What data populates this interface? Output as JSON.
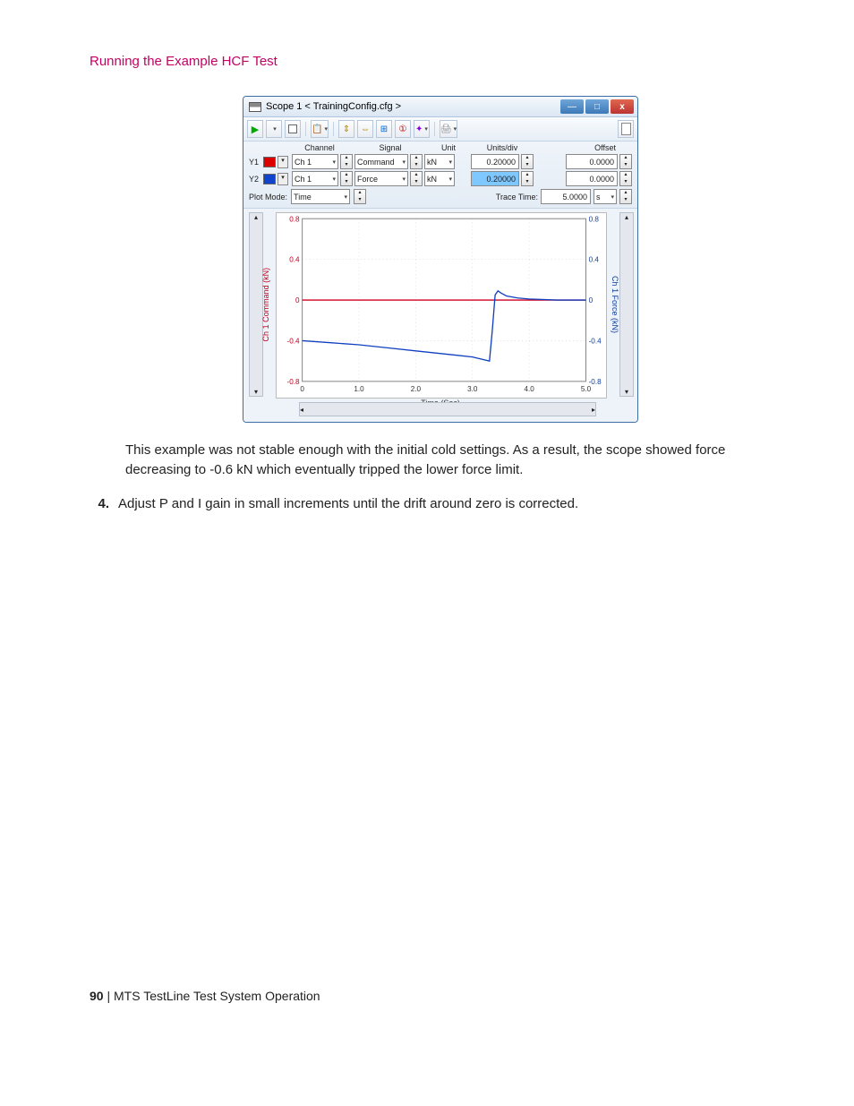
{
  "header": "Running the Example HCF Test",
  "window": {
    "title": "Scope 1 < TrainingConfig.cfg >"
  },
  "config": {
    "hdr_channel": "Channel",
    "hdr_signal": "Signal",
    "hdr_unit": "Unit",
    "hdr_unitsdiv": "Units/div",
    "hdr_offset": "Offset",
    "rows": [
      {
        "ylbl": "Y1",
        "color": "red",
        "channel": "Ch 1",
        "signal": "Command",
        "unit": "kN",
        "unitsdiv": "0.20000",
        "offset": "0.0000"
      },
      {
        "ylbl": "Y2",
        "color": "blue",
        "channel": "Ch 1",
        "signal": "Force",
        "unit": "kN",
        "unitsdiv": "0.20000",
        "offset": "0.0000"
      }
    ],
    "plotmode_label": "Plot Mode:",
    "plotmode_value": "Time",
    "tracetime_label": "Trace Time:",
    "tracetime_value": "5.0000",
    "tracetime_unit": "s"
  },
  "chart_data": {
    "type": "line",
    "xlabel": "Time (Sec)",
    "ylabel_left": "Ch 1 Command (kN)",
    "ylabel_right": "Ch 1 Force (kN)",
    "xlim": [
      0,
      5.0
    ],
    "ylim": [
      -0.8,
      0.8
    ],
    "x_ticks": [
      0,
      1.0,
      2.0,
      3.0,
      4.0,
      5.0
    ],
    "y_ticks": [
      -0.8,
      -0.4,
      0,
      0.4,
      0.8
    ],
    "series": [
      {
        "name": "Ch 1 Command",
        "color": "#d00020",
        "x": [
          0,
          5.0
        ],
        "values": [
          0.0,
          0.0
        ]
      },
      {
        "name": "Ch 1 Force",
        "color": "#1040c0",
        "x": [
          0.0,
          0.5,
          1.0,
          1.5,
          2.0,
          2.5,
          3.0,
          3.3,
          3.35,
          3.4,
          3.45,
          3.5,
          3.6,
          3.8,
          4.0,
          4.5,
          5.0
        ],
        "values": [
          -0.4,
          -0.42,
          -0.44,
          -0.47,
          -0.5,
          -0.53,
          -0.56,
          -0.6,
          -0.3,
          0.05,
          0.09,
          0.07,
          0.04,
          0.02,
          0.01,
          0.0,
          0.0
        ]
      }
    ]
  },
  "body": {
    "p1": "This example was not stable enough with the initial cold settings. As a result, the scope showed force decreasing to -0.6 kN which eventually tripped the lower force limit.",
    "step4_num": "4.",
    "step4_text": "Adjust P and I gain in small increments until the drift around zero is corrected."
  },
  "footer": {
    "page": "90",
    "title": "MTS TestLine Test System Operation"
  }
}
